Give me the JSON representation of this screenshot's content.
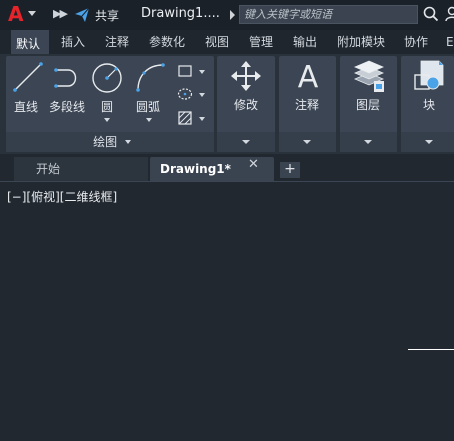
{
  "titlebar": {
    "logo": "A",
    "more": "▶▶",
    "share_label": "共享",
    "doc_title": "Drawing1....",
    "search_placeholder": "键入关键字或短语"
  },
  "ribbon_tabs": [
    {
      "label": "默认",
      "active": true
    },
    {
      "label": "插入"
    },
    {
      "label": "注释"
    },
    {
      "label": "参数化"
    },
    {
      "label": "视图"
    },
    {
      "label": "管理"
    },
    {
      "label": "输出"
    },
    {
      "label": "附加模块"
    },
    {
      "label": "协作"
    },
    {
      "label": "E"
    }
  ],
  "draw_panel": {
    "title": "绘图",
    "tools": {
      "line": "直线",
      "polyline": "多段线",
      "circle": "圆",
      "arc": "圆弧"
    }
  },
  "big_panels": {
    "modify": "修改",
    "annotation": "注释",
    "layers": "图层",
    "block": "块"
  },
  "doc_tabs": {
    "start": "开始",
    "drawing": "Drawing1*",
    "close": "✕",
    "add": "+"
  },
  "viewport_label": "[−][俯视][二维线框]",
  "colors": {
    "accent_red": "#e8242b",
    "share_blue": "#4aa3e8",
    "background": "#212830",
    "panel": "#3b4553"
  }
}
